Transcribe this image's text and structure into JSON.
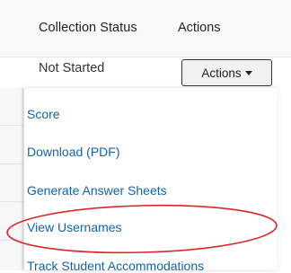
{
  "table": {
    "headers": {
      "collection_status": "Collection Status",
      "actions": "Actions"
    },
    "row": {
      "collection_status": "Not Started",
      "actions_button": "Actions"
    }
  },
  "actions_menu": {
    "items": [
      {
        "label": "Score"
      },
      {
        "label": "Download (PDF)"
      },
      {
        "label": "Generate Answer Sheets"
      },
      {
        "label": "View Usernames",
        "highlighted": true
      },
      {
        "label": "Track Student Accommodations"
      }
    ]
  },
  "colors": {
    "link": "#1462a6",
    "highlight_circle": "#d9262a"
  },
  "icons": {
    "dropdown": "caret-down-icon"
  }
}
